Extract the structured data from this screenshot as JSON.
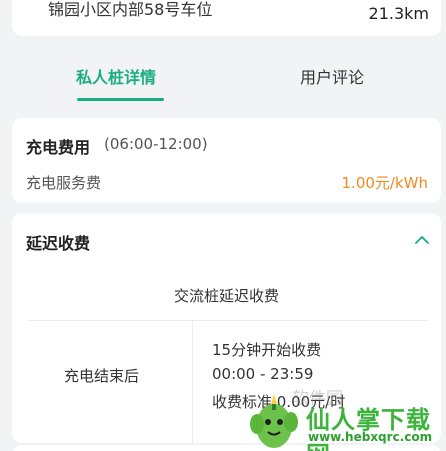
{
  "location": {
    "address": "锦园小区内部58号车位",
    "distance": "21.3km"
  },
  "tabs": [
    {
      "label": "私人桩详情"
    },
    {
      "label": "用户评论"
    }
  ],
  "fee_section": {
    "title": "充电费用",
    "time": "(06:00-12:00)",
    "service_label": "充电服务费",
    "service_value": "1.00元/kWh"
  },
  "delay_section": {
    "title": "延迟收费",
    "subtitle": "交流桩延迟收费",
    "condition": "充电结束后",
    "rules": [
      "15分钟开始收费",
      "00:00 - 23:59",
      "收费标准 0.00元/时"
    ]
  },
  "watermark": {
    "name": "仙人掌下载网",
    "url": "www.hebxqrc.com",
    "faint": "软件园"
  },
  "colors": {
    "accent": "#1aad84",
    "price": "#f08a24",
    "background": "#f2f3f5"
  }
}
